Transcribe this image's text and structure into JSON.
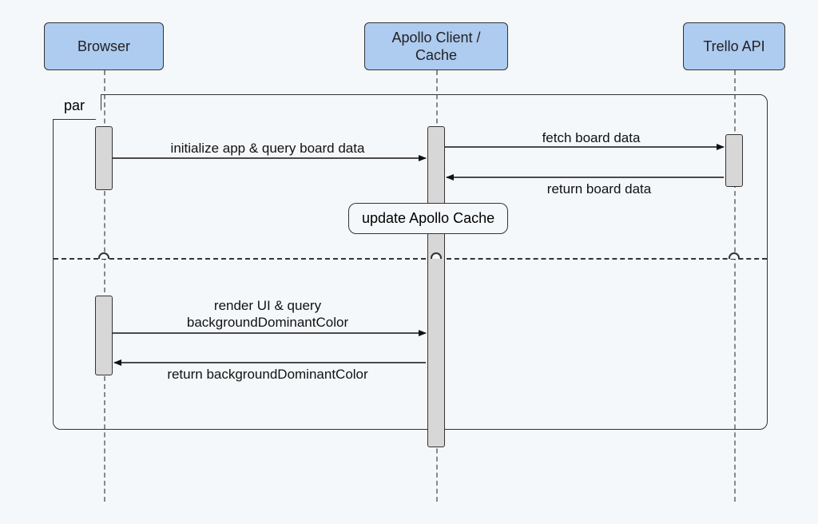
{
  "diagram": {
    "type": "uml-sequence",
    "participants": {
      "browser": "Browser",
      "apollo": "Apollo Client / Cache",
      "trello": "Trello API"
    },
    "fragment_label": "par",
    "messages": {
      "m1": "initialize app & query board data",
      "m2": "fetch board data",
      "m3": "return board data",
      "m4": "render UI & query backgroundDominantColor",
      "m5": "return backgroundDominantColor"
    },
    "note_update": "update Apollo Cache"
  }
}
